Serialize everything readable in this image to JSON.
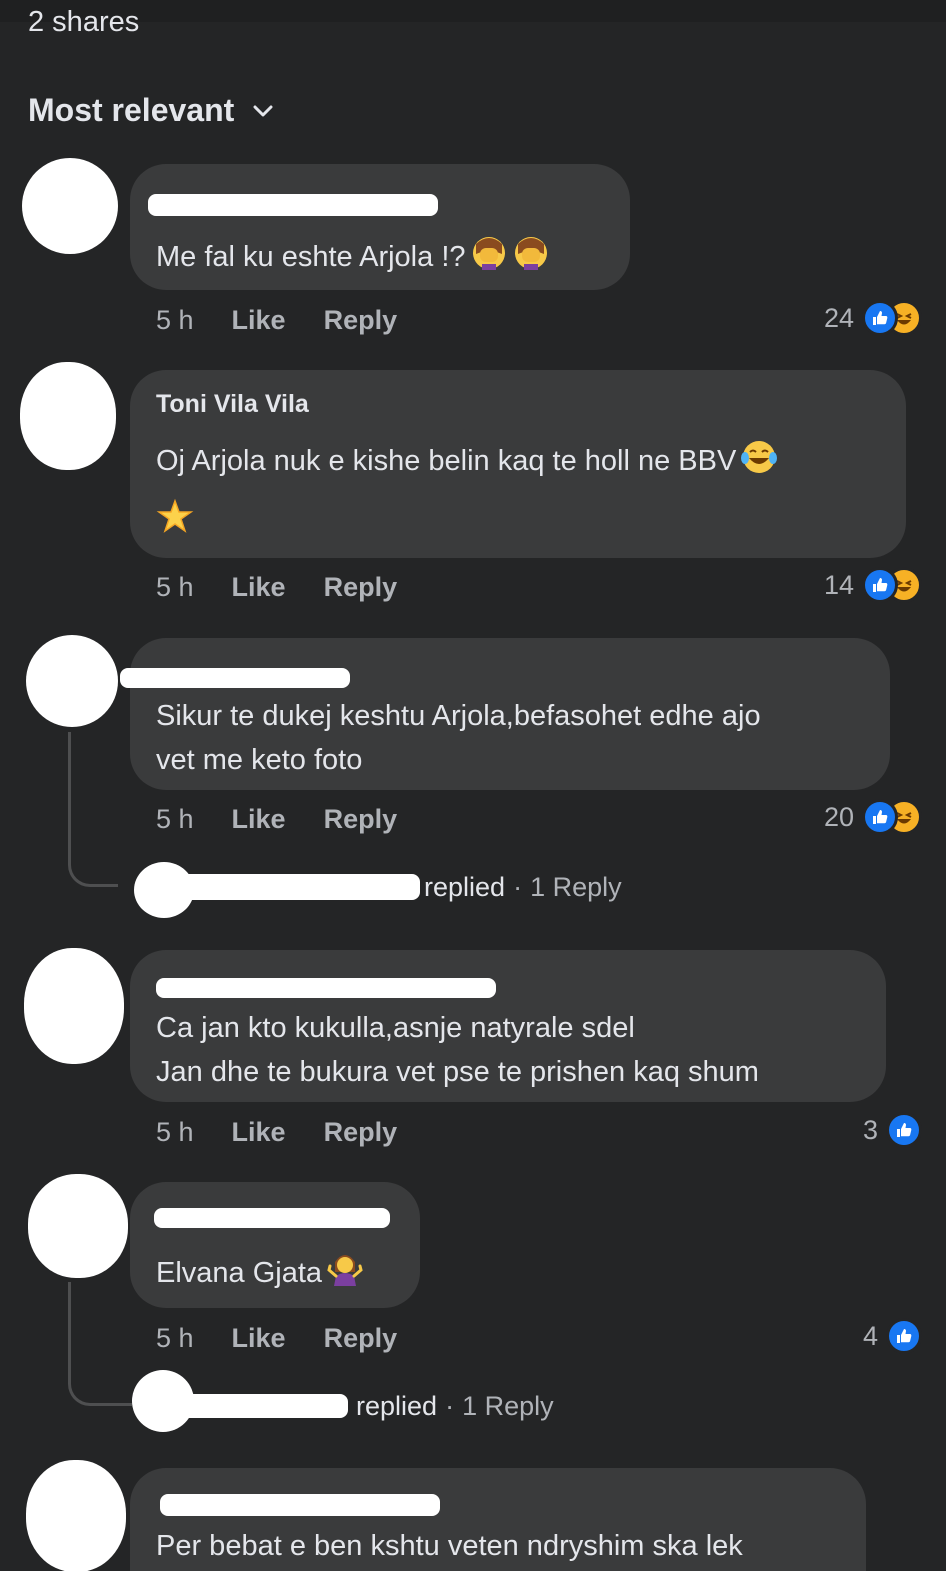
{
  "header": {
    "shares_text": "2 shares",
    "sort_label": "Most relevant"
  },
  "comments": [
    {
      "author": "",
      "text": "Me fal ku eshte Arjola !?",
      "time": "5 h",
      "like_label": "Like",
      "reply_label": "Reply",
      "reaction_count": "24",
      "reactions": [
        "like-icon",
        "haha-icon"
      ]
    },
    {
      "author": "Toni Vila Vila",
      "text": "Oj Arjola nuk e kishe belin kaq te holl ne BBV",
      "text_line2": "",
      "time": "5 h",
      "like_label": "Like",
      "reply_label": "Reply",
      "reaction_count": "14",
      "reactions": [
        "like-icon",
        "haha-icon"
      ]
    },
    {
      "author": "",
      "text": "Sikur te dukej keshtu Arjola,befasohet edhe ajo",
      "text_line2": "vet me keto foto",
      "time": "5 h",
      "like_label": "Like",
      "reply_label": "Reply",
      "reaction_count": "20",
      "reactions": [
        "like-icon",
        "haha-icon"
      ],
      "replies": {
        "replied": "replied",
        "count": "1 Reply"
      }
    },
    {
      "author": "",
      "text": "Ca jan kto kukulla,asnje natyrale sdel",
      "text_line2": "Jan dhe te bukura vet pse te prishen kaq shum",
      "time": "5 h",
      "like_label": "Like",
      "reply_label": "Reply",
      "reaction_count": "3",
      "reactions": [
        "like-icon"
      ]
    },
    {
      "author": "",
      "text": "Elvana Gjata",
      "time": "5 h",
      "like_label": "Like",
      "reply_label": "Reply",
      "reaction_count": "4",
      "reactions": [
        "like-icon"
      ],
      "replies": {
        "replied": "replied",
        "count": "1 Reply"
      }
    },
    {
      "author": "",
      "text": "Per bebat e ben kshtu veten ndryshim ska lek"
    }
  ],
  "colors": {
    "background": "#242526",
    "bubble": "#3a3b3c",
    "like_blue": "#1877f2",
    "haha_yellow": "#f7b125",
    "secondary_text": "#b0b3b8"
  }
}
